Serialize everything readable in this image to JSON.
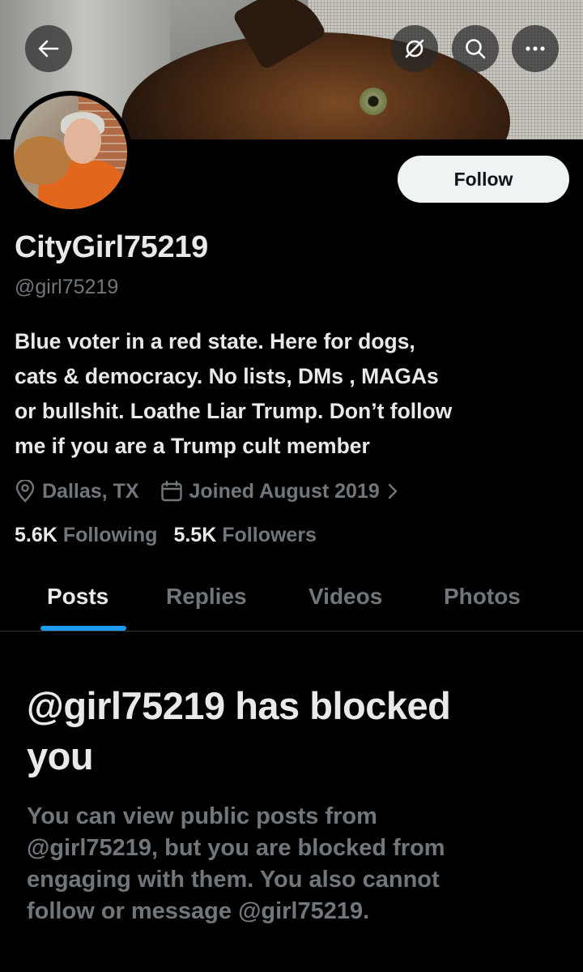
{
  "header": {
    "back_icon": "arrow-left-icon",
    "hide_icon": "eye-slash-circle-icon",
    "search_icon": "search-icon",
    "more_icon": "more-horizontal-icon"
  },
  "profile": {
    "follow_label": "Follow",
    "display_name": "CityGirl75219",
    "handle": "@girl75219",
    "bio_lines": [
      "Blue voter in a red state. Here for dogs,",
      "cats & democracy. No lists, DMs , MAGAs",
      "or bullshit. Loathe Liar Trump. Don’t follow",
      "me if you are a Trump cult member"
    ],
    "location": "Dallas, TX",
    "joined": "Joined August 2019",
    "following_count": "5.6K",
    "following_label": "Following",
    "followers_count": "5.5K",
    "followers_label": "Followers"
  },
  "tabs": [
    {
      "label": "Posts",
      "active": true
    },
    {
      "label": "Replies",
      "active": false
    },
    {
      "label": "Videos",
      "active": false
    },
    {
      "label": "Photos",
      "active": false
    }
  ],
  "blocked": {
    "title_lines": [
      "@girl75219 has blocked",
      "you"
    ],
    "description_lines": [
      "You can view public posts from",
      "@girl75219, but you are blocked from",
      "engaging with them. You also cannot",
      "follow or message @girl75219."
    ]
  },
  "colors": {
    "background": "#000000",
    "text_primary": "#e7e9ea",
    "text_secondary": "#71767b",
    "accent": "#1d9bf0",
    "follow_button_bg": "#eff3f4"
  }
}
